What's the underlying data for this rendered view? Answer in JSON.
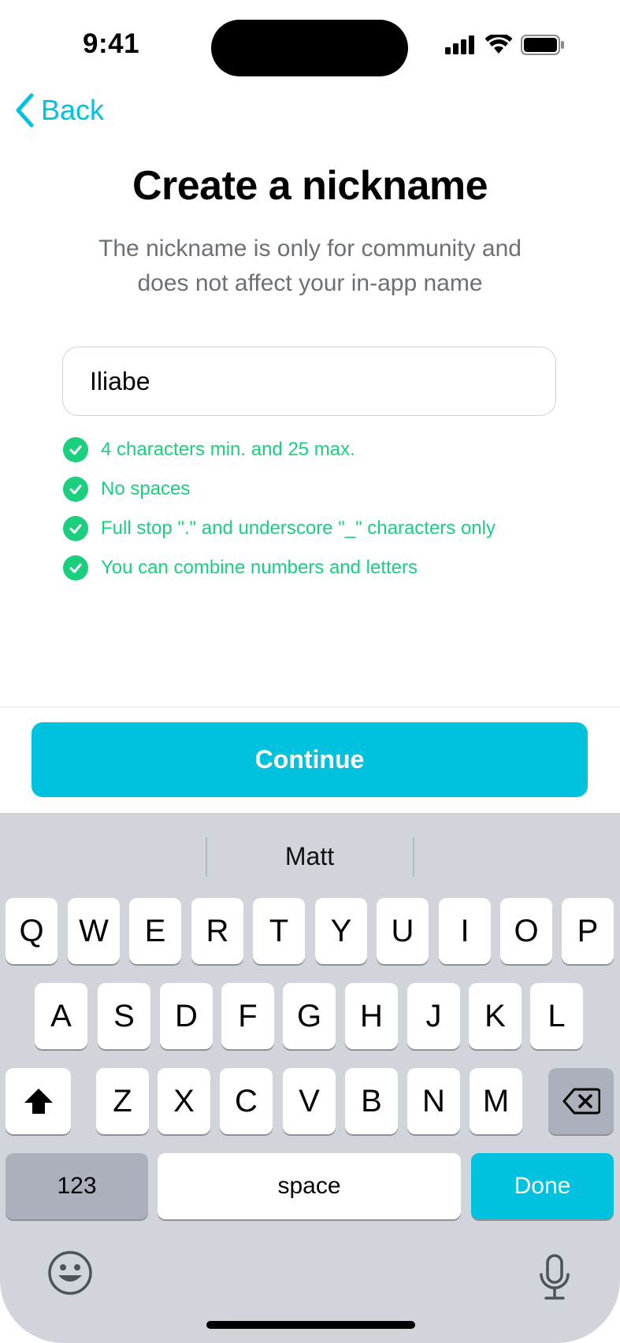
{
  "status_bar": {
    "time": "9:41"
  },
  "nav": {
    "back_label": "Back"
  },
  "page": {
    "title": "Create a nickname",
    "subtitle": "The nickname is only for community and does not affect your in-app name"
  },
  "nickname_input": {
    "value": "Iliabe"
  },
  "rules": [
    {
      "text": "4 characters min. and 25 max.",
      "status": "passed"
    },
    {
      "text": "No spaces",
      "status": "passed"
    },
    {
      "text": "Full stop \".\" and underscore \"_\" characters only",
      "status": "passed"
    },
    {
      "text": "You can combine numbers and letters",
      "status": "passed"
    }
  ],
  "continue_label": "Continue",
  "keyboard": {
    "suggestion": "Matt",
    "row1": [
      "Q",
      "W",
      "E",
      "R",
      "T",
      "Y",
      "U",
      "I",
      "O",
      "P"
    ],
    "row2": [
      "A",
      "S",
      "D",
      "F",
      "G",
      "H",
      "J",
      "K",
      "L"
    ],
    "row3": [
      "Z",
      "X",
      "C",
      "V",
      "B",
      "N",
      "M"
    ],
    "numbers_label": "123",
    "space_label": "space",
    "done_label": "Done"
  },
  "colors": {
    "accent": "#00c2de",
    "success": "#1bcf7e",
    "subtitle": "#6b6f76",
    "keyboard_bg": "#d1d4db"
  }
}
